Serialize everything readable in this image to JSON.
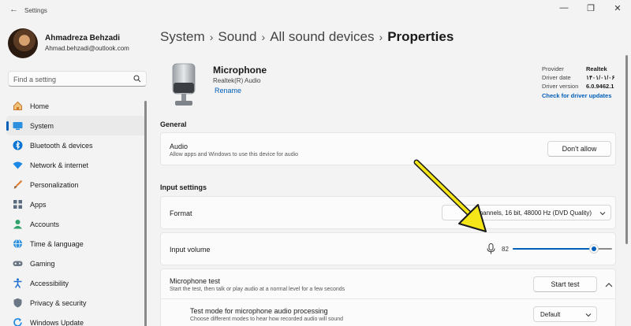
{
  "window": {
    "title": "Settings",
    "back_glyph": "←",
    "minimize_glyph": "—",
    "maximize_glyph": "❐",
    "close_glyph": "✕"
  },
  "profile": {
    "name": "Ahmadreza Behzadi",
    "email": "Ahmad.behzadi@outlook.com"
  },
  "search": {
    "placeholder": "Find a setting"
  },
  "sidebar": {
    "items": [
      {
        "label": "Home",
        "icon": "home-icon"
      },
      {
        "label": "System",
        "icon": "system-icon",
        "active": true
      },
      {
        "label": "Bluetooth & devices",
        "icon": "bluetooth-icon"
      },
      {
        "label": "Network & internet",
        "icon": "wifi-icon"
      },
      {
        "label": "Personalization",
        "icon": "brush-icon"
      },
      {
        "label": "Apps",
        "icon": "apps-icon"
      },
      {
        "label": "Accounts",
        "icon": "accounts-icon"
      },
      {
        "label": "Time & language",
        "icon": "globe-icon"
      },
      {
        "label": "Gaming",
        "icon": "gaming-icon"
      },
      {
        "label": "Accessibility",
        "icon": "accessibility-icon"
      },
      {
        "label": "Privacy & security",
        "icon": "shield-icon"
      },
      {
        "label": "Windows Update",
        "icon": "update-icon"
      }
    ]
  },
  "breadcrumb": {
    "items": [
      "System",
      "Sound",
      "All sound devices"
    ],
    "current": "Properties",
    "separator": "›"
  },
  "device": {
    "name": "Microphone",
    "subtitle": "Realtek(R) Audio",
    "rename_label": "Rename",
    "driver": {
      "provider_label": "Provider",
      "provider": "Realtek",
      "date_label": "Driver date",
      "date": "۱۴۰۱/۰۱/۰۶",
      "version_label": "Driver version",
      "version": "6.0.9462.1",
      "check_label": "Check for driver updates"
    }
  },
  "general": {
    "title": "General",
    "audio_label": "Audio",
    "audio_desc": "Allow apps and Windows to use this device for audio",
    "dont_allow_label": "Don't allow"
  },
  "input_settings": {
    "title": "Input settings",
    "format_label": "Format",
    "format_value": "2 channels, 16 bit, 48000 Hz (DVD Quality)",
    "volume_label": "Input volume",
    "volume_value": "82",
    "volume_fraction": 0.82,
    "mic_test_label": "Microphone test",
    "mic_test_desc": "Start the test, then talk or play audio at a normal level for a few seconds",
    "start_test_label": "Start test",
    "test_mode_label": "Test mode for microphone audio processing",
    "test_mode_desc": "Choose different modes to hear how recorded audio will sound",
    "test_mode_value": "Default"
  },
  "colors": {
    "accent": "#005fb8",
    "annotation_arrow": "#f5e61a"
  }
}
